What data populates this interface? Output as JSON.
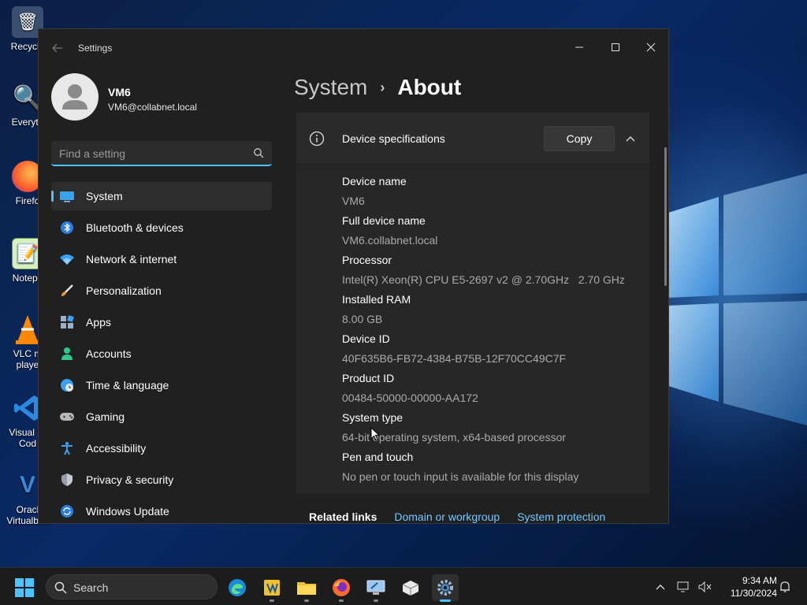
{
  "desktop": {
    "icons": [
      {
        "label": "Recycle",
        "icon": "recycle-bin-icon"
      },
      {
        "label": "Everyth",
        "icon": "everything-search-icon"
      },
      {
        "label": "Firefo",
        "icon": "firefox-icon"
      },
      {
        "label": "Notepa",
        "icon": "notepad-icon"
      },
      {
        "label": "VLC m\nplaye",
        "icon": "vlc-icon"
      },
      {
        "label": "Visual St\nCod",
        "icon": "vscode-icon"
      },
      {
        "label": "Oracl\nVirtualbox",
        "icon": "virtualbox-icon"
      }
    ]
  },
  "window": {
    "app_title": "Settings"
  },
  "profile": {
    "name": "VM6",
    "email": "VM6@collabnet.local"
  },
  "search": {
    "placeholder": "Find a setting"
  },
  "nav": {
    "items": [
      {
        "label": "System",
        "icon": "system-monitor-icon",
        "active": true
      },
      {
        "label": "Bluetooth & devices",
        "icon": "bluetooth-icon"
      },
      {
        "label": "Network & internet",
        "icon": "wifi-icon"
      },
      {
        "label": "Personalization",
        "icon": "brush-icon"
      },
      {
        "label": "Apps",
        "icon": "apps-icon"
      },
      {
        "label": "Accounts",
        "icon": "accounts-icon"
      },
      {
        "label": "Time & language",
        "icon": "globe-clock-icon"
      },
      {
        "label": "Gaming",
        "icon": "gamepad-icon"
      },
      {
        "label": "Accessibility",
        "icon": "accessibility-icon"
      },
      {
        "label": "Privacy & security",
        "icon": "shield-icon"
      },
      {
        "label": "Windows Update",
        "icon": "update-icon"
      }
    ]
  },
  "breadcrumb": {
    "parent": "System",
    "separator": "›",
    "current": "About"
  },
  "device_specs": {
    "title": "Device specifications",
    "copy_label": "Copy",
    "items": [
      {
        "key": "Device name",
        "value": "VM6"
      },
      {
        "key": "Full device name",
        "value": "VM6.collabnet.local"
      },
      {
        "key": "Processor",
        "value": "Intel(R) Xeon(R) CPU E5-2697 v2 @ 2.70GHz   2.70 GHz"
      },
      {
        "key": "Installed RAM",
        "value": "8.00 GB"
      },
      {
        "key": "Device ID",
        "value": "40F635B6-FB72-4384-B75B-12F70CC49C7F"
      },
      {
        "key": "Product ID",
        "value": "00484-50000-00000-AA172"
      },
      {
        "key": "System type",
        "value": "64-bit operating system, x64-based processor"
      },
      {
        "key": "Pen and touch",
        "value": "No pen or touch input is available for this display"
      }
    ]
  },
  "related": {
    "title": "Related links",
    "links": [
      "Domain or workgroup",
      "System protection"
    ]
  },
  "taskbar": {
    "search_label": "Search",
    "time": "9:34 AM",
    "date": "11/30/2024"
  },
  "colors": {
    "accent": "#4cc2ff",
    "link": "#75c8ff",
    "window_bg": "#202020"
  }
}
